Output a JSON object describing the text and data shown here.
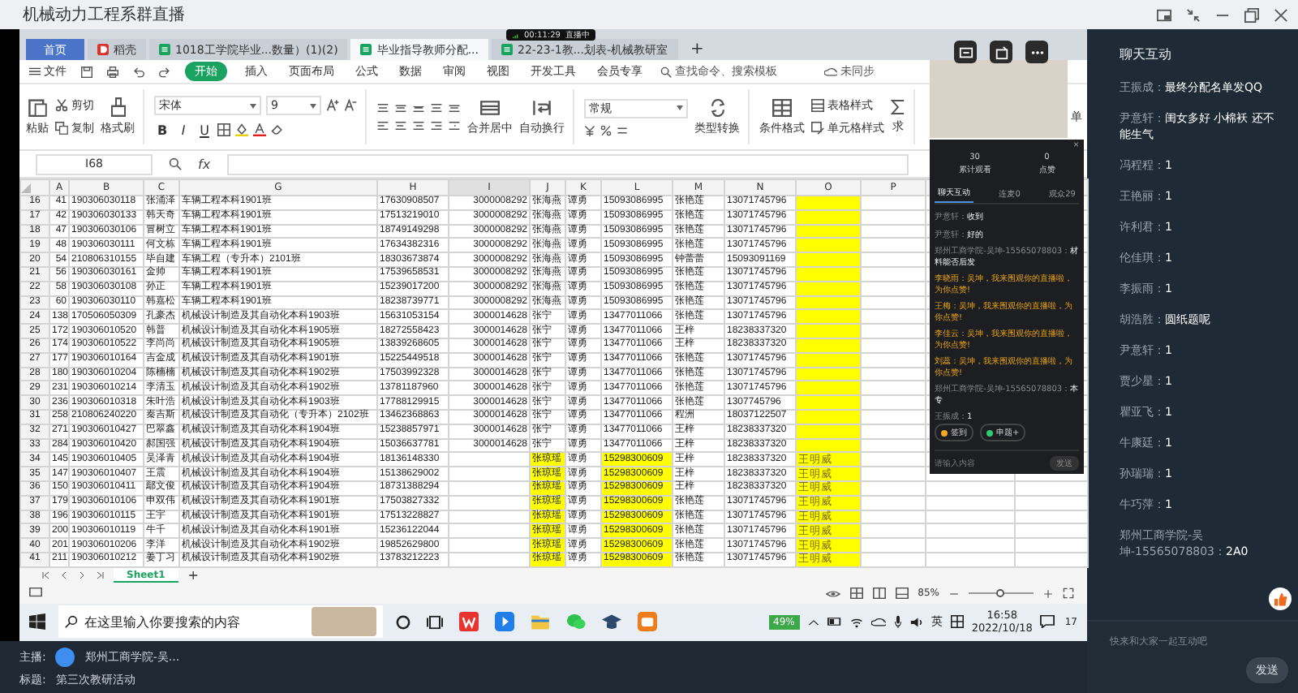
{
  "window": {
    "title": "机械动力工程系群直播"
  },
  "screen": {
    "live_badge": {
      "time": "00:11:29",
      "status": "直播中"
    },
    "doc_tabs": [
      {
        "label": "首页",
        "selected": false,
        "kind": "home"
      },
      {
        "label": "稻壳",
        "selected": false,
        "kind": "app"
      },
      {
        "label": "1018工学院毕业...数量）(1)(2)",
        "selected": false,
        "kind": "sheet"
      },
      {
        "label": "毕业指导教师分配...",
        "selected": true,
        "kind": "sheet"
      },
      {
        "label": "22-23-1教...划表-机械教研室",
        "selected": false,
        "kind": "sheet"
      }
    ],
    "new_tab": "+",
    "menu": {
      "file": "文件",
      "items": [
        {
          "label": "开始",
          "selected": true
        },
        {
          "label": "插入",
          "selected": false
        },
        {
          "label": "页面布局",
          "selected": false
        },
        {
          "label": "公式",
          "selected": false
        },
        {
          "label": "数据",
          "selected": false
        },
        {
          "label": "审阅",
          "selected": false
        },
        {
          "label": "视图",
          "selected": false
        },
        {
          "label": "开发工具",
          "selected": false
        },
        {
          "label": "会员专享",
          "selected": false
        }
      ],
      "search": {
        "placeholder": "查找命令、搜索模板"
      },
      "sync": "未同步"
    },
    "ribbon": {
      "paste": "粘贴",
      "cut": "剪切",
      "copy": "复制",
      "format_painter": "格式刷",
      "font": "宋体",
      "font_size": "9",
      "styles": [
        "B",
        "I",
        "U"
      ],
      "merge": "合并居中",
      "wrap": "自动换行",
      "number_format": "常规",
      "convert": "类型转换",
      "conditional": "条件格式",
      "table_style": "表格样式",
      "cell_style": "单元格样式",
      "sum": "求",
      "edge": "单"
    },
    "formula_bar": {
      "cell": "I68",
      "fx": "fx"
    },
    "sheet": {
      "columns": [
        {
          "label": "A",
          "selected": false,
          "kind": "number"
        },
        {
          "label": "B",
          "selected": false,
          "kind": "text"
        },
        {
          "label": "C",
          "selected": false,
          "kind": "text"
        },
        {
          "label": "G",
          "selected": false,
          "kind": "text"
        },
        {
          "label": "H",
          "selected": false,
          "kind": "text"
        },
        {
          "label": "I",
          "selected": true,
          "kind": "number"
        },
        {
          "label": "J",
          "selected": false,
          "kind": "text"
        },
        {
          "label": "K",
          "selected": false,
          "kind": "text"
        },
        {
          "label": "L",
          "selected": false,
          "kind": "text"
        },
        {
          "label": "M",
          "selected": false,
          "kind": "text"
        },
        {
          "label": "N",
          "selected": false,
          "kind": "text"
        },
        {
          "label": "O",
          "selected": false,
          "kind": "serif"
        },
        {
          "label": "P",
          "selected": false,
          "kind": "text"
        }
      ],
      "rows": [
        {
          "num": "16",
          "cells": [
            "41",
            "190306030118",
            "张涌泽",
            "车辆工程本科1901班",
            "17630908507",
            "3000008292",
            "张海燕",
            "谭勇",
            "15093086995",
            "张艳莲",
            "13071745796",
            {
              "filled": true
            },
            null
          ]
        },
        {
          "num": "17",
          "cells": [
            "42",
            "190306030133",
            "韩天奇",
            "车辆工程本科1901班",
            "17513219010",
            "3000008292",
            "张海燕",
            "谭勇",
            "15093086995",
            "张艳莲",
            "13071745796",
            {
              "filled": true
            },
            null
          ]
        },
        {
          "num": "18",
          "cells": [
            "47",
            "190306030106",
            "冒树立",
            "车辆工程本科1901班",
            "18749149298",
            "3000008292",
            "张海燕",
            "谭勇",
            "15093086995",
            "张艳莲",
            "13071745796",
            {
              "filled": true
            },
            null
          ]
        },
        {
          "num": "19",
          "cells": [
            "48",
            "190306030111",
            "何文栋",
            "车辆工程本科1901班",
            "17634382316",
            "3000008292",
            "张海燕",
            "谭勇",
            "15093086995",
            "张艳莲",
            "13071745796",
            {
              "filled": true
            },
            null
          ]
        },
        {
          "num": "20",
          "cells": [
            "54",
            "210806310155",
            "毕自建",
            "车辆工程（专升本）2101班",
            "18303673874",
            "3000008292",
            "张海燕",
            "谭勇",
            "15093086995",
            "钟蕾蕾",
            "15093091169",
            {
              "filled": true
            },
            null
          ]
        },
        {
          "num": "21",
          "cells": [
            "56",
            "190306030161",
            "金帅",
            "车辆工程本科1901班",
            "17539658531",
            "3000008292",
            "张海燕",
            "谭勇",
            "15093086995",
            "张艳莲",
            "13071745796",
            {
              "filled": true
            },
            null
          ]
        },
        {
          "num": "22",
          "cells": [
            "58",
            "190306030108",
            "孙正",
            "车辆工程本科1901班",
            "15239017200",
            "3000008292",
            "张海燕",
            "谭勇",
            "15093086995",
            "张艳莲",
            "13071745796",
            {
              "filled": true
            },
            null
          ]
        },
        {
          "num": "23",
          "cells": [
            "60",
            "190306030110",
            "韩嘉松",
            "车辆工程本科1901班",
            "18238739771",
            "3000008292",
            "张海燕",
            "谭勇",
            "15093086995",
            "张艳莲",
            "13071745796",
            {
              "filled": true
            },
            null
          ]
        },
        {
          "num": "24",
          "cells": [
            "138",
            "170506050309",
            "孔豪杰",
            "机械设计制造及其自动化本科1903班",
            "15631053154",
            "3000014628",
            "张宁",
            "谭勇",
            "13477011066",
            "张艳莲",
            "13071745796",
            {
              "filled": true
            },
            null
          ]
        },
        {
          "num": "25",
          "cells": [
            "172",
            "190306010520",
            "韩普",
            "机械设计制造及其自动化本科1905班",
            "18272558423",
            "3000014628",
            "张宁",
            "谭勇",
            "13477011066",
            "王梓",
            "18238337320",
            {
              "filled": true
            },
            null
          ]
        },
        {
          "num": "26",
          "cells": [
            "174",
            "190306010522",
            "李尚尚",
            "机械设计制造及其自动化本科1905班",
            "13839268605",
            "3000014628",
            "张宁",
            "谭勇",
            "13477011066",
            "王梓",
            "18238337320",
            {
              "filled": true
            },
            null
          ]
        },
        {
          "num": "27",
          "cells": [
            "177",
            "190306010164",
            "吉金成",
            "机械设计制造及其自动化本科1901班",
            "15225449518",
            "3000014628",
            "张宁",
            "谭勇",
            "13477011066",
            "张艳莲",
            "13071745796",
            {
              "filled": true
            },
            null
          ]
        },
        {
          "num": "28",
          "cells": [
            "180",
            "190306010204",
            "陈楠楠",
            "机械设计制造及其自动化本科1902班",
            "17503992328",
            "3000014628",
            "张宁",
            "谭勇",
            "13477011066",
            "张艳莲",
            "13071745796",
            {
              "filled": true
            },
            null
          ]
        },
        {
          "num": "29",
          "cells": [
            "231",
            "190306010214",
            "李清玉",
            "机械设计制造及其自动化本科1902班",
            "13781187960",
            "3000014628",
            "张宁",
            "谭勇",
            "13477011066",
            "张艳莲",
            "13071745796",
            {
              "filled": true
            },
            null
          ]
        },
        {
          "num": "30",
          "cells": [
            "236",
            "190306010318",
            "朱叶浩",
            "机械设计制造及其自动化本科1903班",
            "17788129915",
            "3000014628",
            "张宁",
            "谭勇",
            "13477011066",
            "张艳莲",
            "1307745796",
            {
              "filled": true
            },
            null
          ]
        },
        {
          "num": "31",
          "cells": [
            "258",
            "210806240220",
            "秦吉斯",
            "机械设计制造及其自动化（专升本）2102班",
            "13462368863",
            "3000014628",
            "张宁",
            "谭勇",
            "13477011066",
            "程洲",
            "18037122507",
            {
              "filled": true
            },
            null
          ]
        },
        {
          "num": "32",
          "cells": [
            "271",
            "190306010427",
            "巴翠鑫",
            "机械设计制造及其自动化本科1904班",
            "15238857971",
            "3000014628",
            "张宁",
            "谭勇",
            "13477011066",
            "王梓",
            "18238337320",
            {
              "filled": true
            },
            null
          ]
        },
        {
          "num": "33",
          "cells": [
            "284",
            "190306010420",
            "郝国强",
            "机械设计制造及其自动化本科1904班",
            "15036637781",
            "3000014628",
            "张宁",
            "谭勇",
            "13477011066",
            "王梓",
            "18238337320",
            {
              "filled": true
            },
            null
          ]
        },
        {
          "num": "34",
          "cells": [
            "145",
            "190306010405",
            "吴泽青",
            "机械设计制造及其自动化本科1904班",
            "18136148330",
            null,
            {
              "text": "张琼瑶",
              "filled": true
            },
            "谭勇",
            {
              "text": "15298300609",
              "filled": true
            },
            "王梓",
            "18238337320",
            {
              "text": "王明威",
              "filled": true
            },
            null
          ]
        },
        {
          "num": "35",
          "cells": [
            "147",
            "190306010407",
            "王震",
            "机械设计制造及其自动化本科1904班",
            "15138629002",
            null,
            {
              "text": "张琼瑶",
              "filled": true
            },
            "谭勇",
            {
              "text": "15298300609",
              "filled": true
            },
            "王梓",
            "18238337320",
            {
              "text": "王明威",
              "filled": true
            },
            null
          ]
        },
        {
          "num": "36",
          "cells": [
            "150",
            "190306010411",
            "鄢文俊",
            "机械设计制造及其自动化本科1904班",
            "18731388294",
            null,
            {
              "text": "张琼瑶",
              "filled": true
            },
            "谭勇",
            {
              "text": "15298300609",
              "filled": true
            },
            "王梓",
            "18238337320",
            {
              "text": "王明威",
              "filled": true
            },
            null
          ]
        },
        {
          "num": "37",
          "cells": [
            "179",
            "190306010106",
            "申双伟",
            "机械设计制造及其自动化本科1901班",
            "17503827332",
            null,
            {
              "text": "张琼瑶",
              "filled": true
            },
            "谭勇",
            {
              "text": "15298300609",
              "filled": true
            },
            "张艳莲",
            "13071745796",
            {
              "text": "王明威",
              "filled": true
            },
            null
          ]
        },
        {
          "num": "38",
          "cells": [
            "196",
            "190306010115",
            "王宇",
            "机械设计制造及其自动化本科1901班",
            "17513228827",
            null,
            {
              "text": "张琼瑶",
              "filled": true
            },
            "谭勇",
            {
              "text": "15298300609",
              "filled": true
            },
            "张艳莲",
            "13071745796",
            {
              "text": "王明威",
              "filled": true
            },
            null
          ]
        },
        {
          "num": "39",
          "cells": [
            "200",
            "190306010119",
            "牛千",
            "机械设计制造及其自动化本科1901班",
            "15236122044",
            null,
            {
              "text": "张琼瑶",
              "filled": true
            },
            "谭勇",
            {
              "text": "15298300609",
              "filled": true
            },
            "张艳莲",
            "13071745796",
            {
              "text": "王明威",
              "filled": true
            },
            null
          ]
        },
        {
          "num": "40",
          "cells": [
            "201",
            "190306010206",
            "李洋",
            "机械设计制造及其自动化本科1902班",
            "19852629800",
            null,
            {
              "text": "张琼瑶",
              "filled": true
            },
            "谭勇",
            {
              "text": "15298300609",
              "filled": true
            },
            "张艳莲",
            "13071745796",
            {
              "text": "王明威",
              "filled": true
            },
            null
          ]
        },
        {
          "num": "41",
          "cells": [
            "211",
            "190306010212",
            "姜丁习",
            "机械设计制造及其自动化本科1902班",
            "13783212223",
            null,
            {
              "text": "张琼瑶",
              "filled": true
            },
            "谭勇",
            {
              "text": "15298300609",
              "filled": true
            },
            "张艳莲",
            "13071745796",
            {
              "text": "王明威",
              "filled": true
            },
            null
          ]
        }
      ]
    },
    "sheet_tabs": [
      {
        "label": "Sheet1",
        "selected": true
      }
    ],
    "add_sheet": "+",
    "status_bar": {
      "zoom": "85%",
      "zoom_slider": {
        "level": 0.5
      }
    },
    "taskbar": {
      "search": {
        "placeholder": "在这里输入你要搜索的内容"
      },
      "battery": "49%",
      "language": "英",
      "time": "16:58",
      "date": "2022/10/18",
      "notifications": "17"
    },
    "overlay_chat": {
      "close": "×",
      "stats": [
        {
          "value": "30",
          "label": "累计观看"
        },
        {
          "value": "0",
          "label": "点赞"
        }
      ],
      "tabs": [
        {
          "label": "聊天互动",
          "selected": true
        },
        {
          "label": "连麦0",
          "selected": false
        },
        {
          "label": "观众29",
          "selected": false
        }
      ],
      "messages": [
        {
          "name": "尹意轩：",
          "text": "收到",
          "kind": "user"
        },
        {
          "name": "尹意轩：",
          "text": "好的",
          "kind": "user"
        },
        {
          "name": "郑州工商学院-吴坤-15565078803：",
          "text": "材料能否后发",
          "kind": "user"
        },
        {
          "name": "李晓雨：",
          "text": "吴坤，我来围观你的直播啦，为你点赞!",
          "kind": "system"
        },
        {
          "name": "王梅：",
          "text": "吴坤，我来围观你的直播啦，为你点赞!",
          "kind": "system"
        },
        {
          "name": "李佳云：",
          "text": "吴坤，我来围观你的直播啦，为你点赞!",
          "kind": "system"
        },
        {
          "name": "刘蕊：",
          "text": "吴坤，我来围观你的直播啦，为你点赞!",
          "kind": "system"
        },
        {
          "name": "郑州工商学院-吴坤-15565078803：",
          "text": "本专",
          "kind": "user"
        },
        {
          "name": "王振成：",
          "text": "1",
          "kind": "user"
        }
      ],
      "actions": [
        {
          "label": "签到",
          "color": "#f5a623"
        },
        {
          "label": "申题+",
          "color": "#2ecc71"
        }
      ],
      "input": {
        "placeholder": "请输入内容"
      },
      "send": "发送"
    }
  },
  "host_bar": {
    "host_label": "主播:",
    "host": "郑州工商学院-吴...",
    "title_label": "标题:",
    "title": "第三次教研活动"
  },
  "chat": {
    "title": "聊天互动",
    "messages": [
      {
        "name": "王振成：",
        "text": "最终分配名单发QQ"
      },
      {
        "name": "尹意轩：",
        "text": "闺女多好 小棉袄 还不能生气"
      },
      {
        "name": "冯程程：",
        "text": "1"
      },
      {
        "name": "王艳丽：",
        "text": "1"
      },
      {
        "name": "许利君：",
        "text": "1"
      },
      {
        "name": "伦佳琪：",
        "text": "1"
      },
      {
        "name": "李振雨：",
        "text": "1"
      },
      {
        "name": "胡浩胜：",
        "text": "圆纸题呢"
      },
      {
        "name": "尹意轩：",
        "text": "1"
      },
      {
        "name": "贾少星：",
        "text": "1"
      },
      {
        "name": "瞿亚飞：",
        "text": "1"
      },
      {
        "name": "牛康廷：",
        "text": "1"
      },
      {
        "name": "孙瑞瑞：",
        "text": "1"
      },
      {
        "name": "牛巧萍：",
        "text": "1"
      },
      {
        "name": "郑州工商学院-吴坤-15565078803：",
        "text": "2A0"
      }
    ],
    "input": {
      "placeholder": "快来和大家一起互动吧"
    },
    "send": "发送"
  }
}
